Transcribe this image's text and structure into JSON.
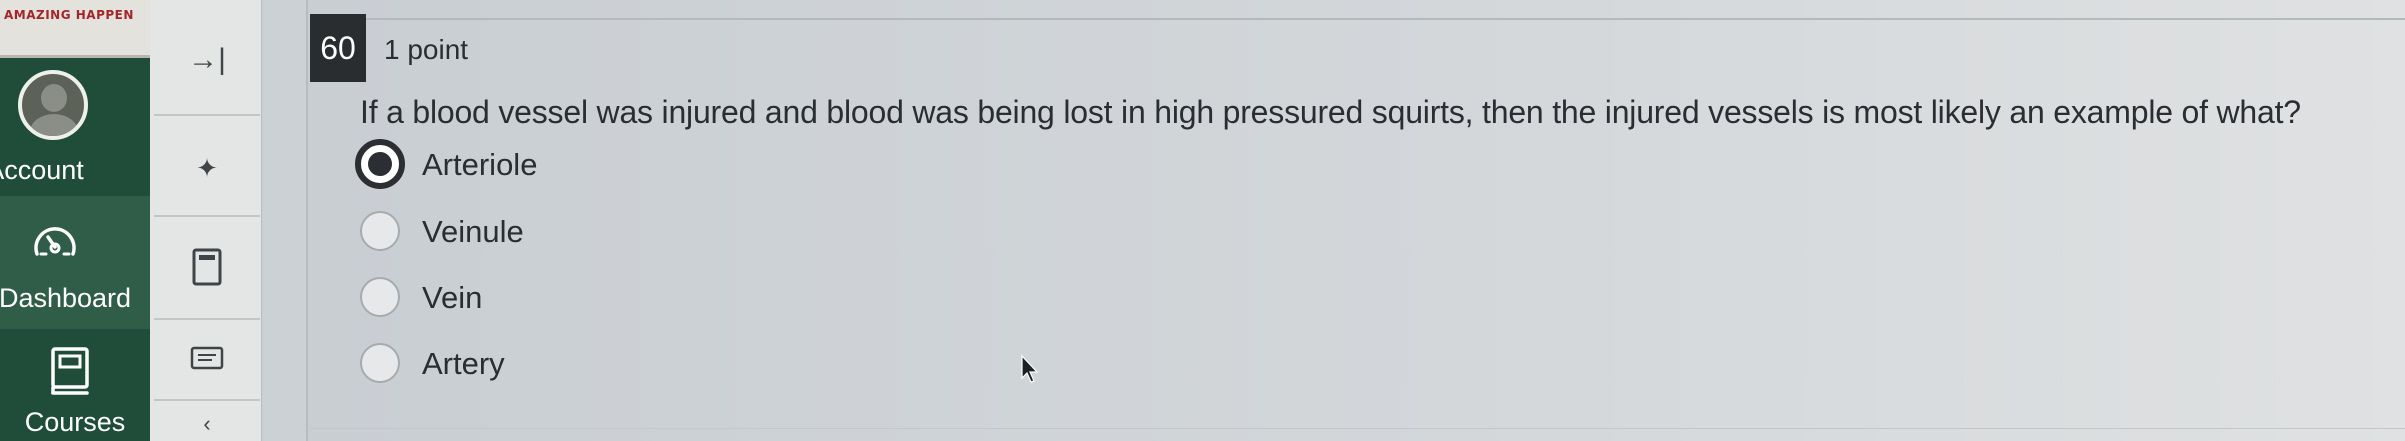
{
  "global_nav": {
    "logo_text": "AMAZING HAPPEN",
    "account_label": "Account",
    "dashboard_label": "Dashboard",
    "courses_label": "Courses"
  },
  "course_nav": {
    "collapse_glyph": "→|",
    "pin_glyph": "✦",
    "more_glyph": "‹"
  },
  "question": {
    "number": "60",
    "points": "1 point",
    "text": "If a blood vessel was injured and blood was being lost in high pressured squirts, then the injured vessels is most likely an example of what?",
    "selected_index": 0,
    "answers": [
      "Arteriole",
      "Veinule",
      "Vein",
      "Artery"
    ]
  },
  "colors": {
    "nav_green": "#1f4d39",
    "nav_active": "#2f5d47",
    "question_badge": "#2a2d30",
    "text": "#2a2d31"
  },
  "icons": {
    "avatar": "user-avatar-icon",
    "dashboard": "speedometer-icon",
    "courses": "book-icon",
    "collapse": "collapse-arrow-icon",
    "pin": "pin-icon",
    "calculator": "calculator-icon",
    "notes": "notes-icon",
    "cursor": "mouse-cursor-icon"
  }
}
